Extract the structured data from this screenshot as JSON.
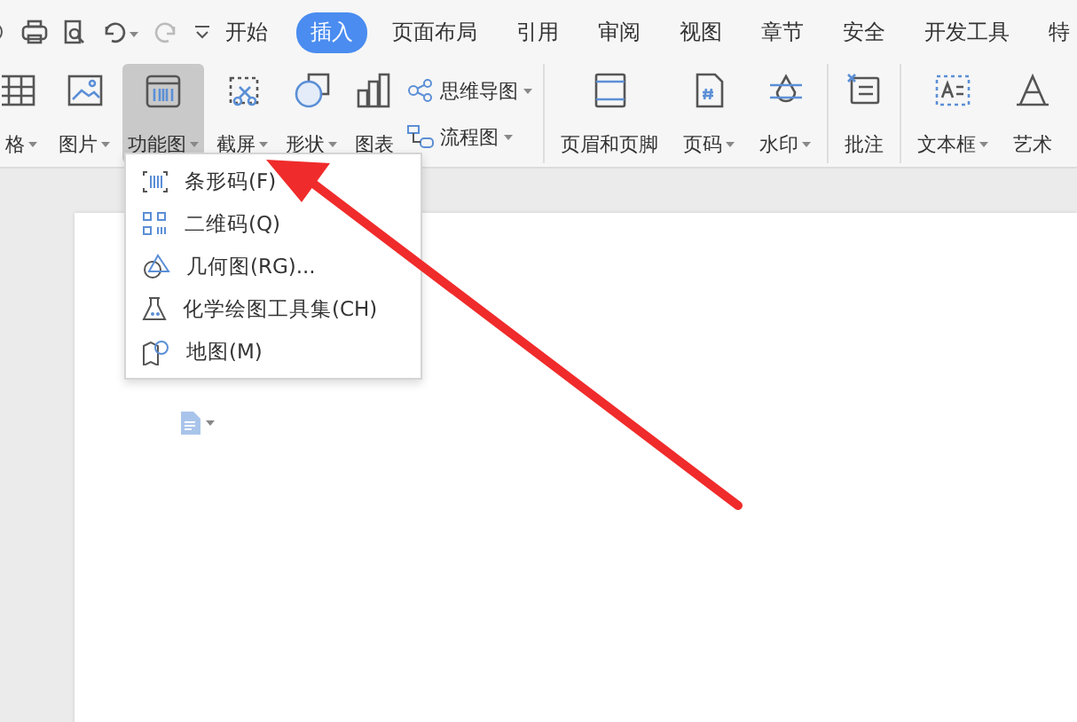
{
  "menu_tabs": [
    {
      "label": "开始",
      "selected": false
    },
    {
      "label": "插入",
      "selected": true
    },
    {
      "label": "页面布局",
      "selected": false
    },
    {
      "label": "引用",
      "selected": false
    },
    {
      "label": "审阅",
      "selected": false
    },
    {
      "label": "视图",
      "selected": false
    },
    {
      "label": "章节",
      "selected": false
    },
    {
      "label": "安全",
      "selected": false
    },
    {
      "label": "开发工具",
      "selected": false
    },
    {
      "label": "特",
      "selected": false
    }
  ],
  "ribbon": {
    "groups": [
      [
        {
          "kind": "large",
          "label": "格",
          "dropdown": true,
          "selected": false
        },
        {
          "kind": "large",
          "label": "图片",
          "dropdown": true,
          "selected": false
        },
        {
          "kind": "large",
          "label": "功能图",
          "dropdown": true,
          "selected": true
        },
        {
          "kind": "large",
          "label": "截屏",
          "dropdown": true,
          "selected": false
        },
        {
          "kind": "large",
          "label": "形状",
          "dropdown": true,
          "selected": false
        },
        {
          "kind": "large",
          "label": "图表",
          "dropdown": false,
          "selected": false
        },
        {
          "kind": "small",
          "label": "思维导图",
          "dropdown": true
        },
        {
          "kind": "small",
          "label": "流程图",
          "dropdown": true
        }
      ],
      [
        {
          "kind": "large",
          "label": "页眉和页脚",
          "dropdown": false,
          "selected": false
        },
        {
          "kind": "large",
          "label": "页码",
          "dropdown": true,
          "selected": false
        },
        {
          "kind": "large",
          "label": "水印",
          "dropdown": true,
          "selected": false
        }
      ],
      [
        {
          "kind": "large",
          "label": "批注",
          "dropdown": false,
          "selected": false
        }
      ],
      [
        {
          "kind": "large",
          "label": "文本框",
          "dropdown": true,
          "selected": false
        },
        {
          "kind": "large",
          "label": "艺术",
          "dropdown": false,
          "selected": false
        }
      ]
    ]
  },
  "dropdown_menu": {
    "items": [
      {
        "label": "条形码(F)"
      },
      {
        "label": "二维码(Q)"
      },
      {
        "label": "几何图(RG)..."
      },
      {
        "label": "化学绘图工具集(CH)"
      },
      {
        "label": "地图(M)"
      }
    ]
  }
}
